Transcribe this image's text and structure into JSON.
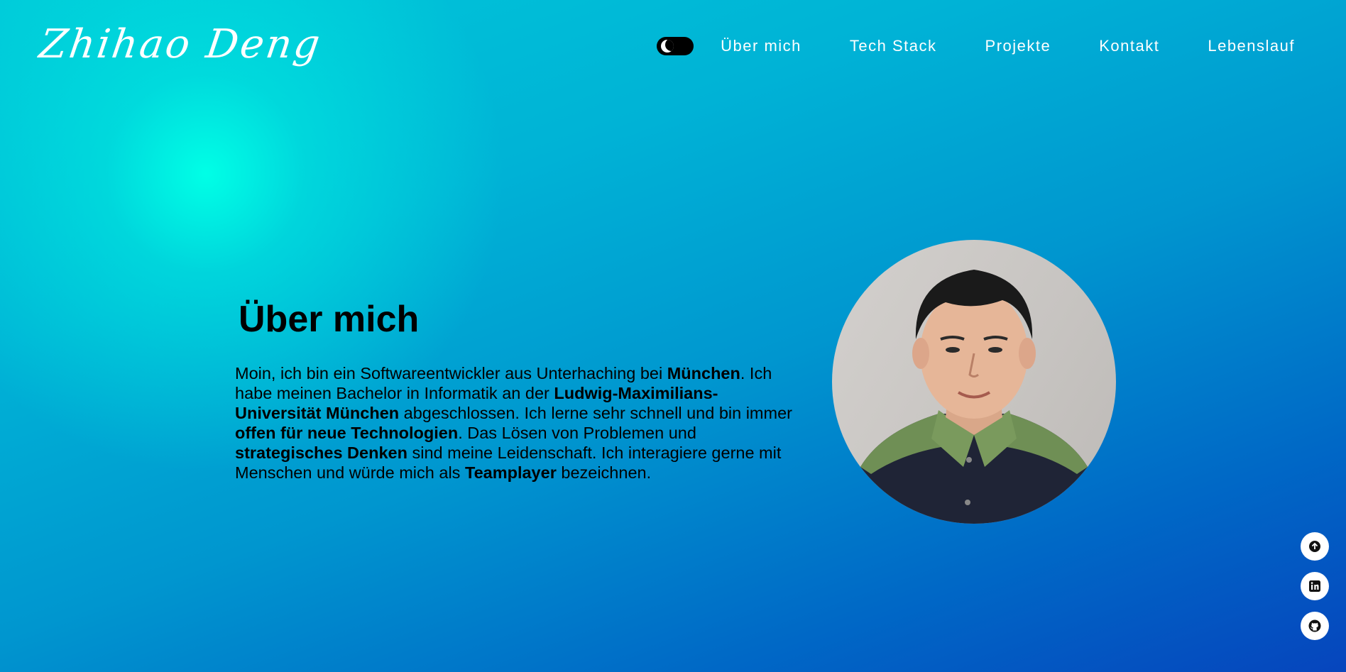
{
  "header": {
    "logo": "Zhihao Deng",
    "theme_toggle": "dark-mode-toggle",
    "nav": [
      {
        "label": "Über mich"
      },
      {
        "label": "Tech Stack"
      },
      {
        "label": "Projekte"
      },
      {
        "label": "Kontakt"
      },
      {
        "label": "Lebenslauf"
      }
    ]
  },
  "about": {
    "title": "Über mich",
    "p1": "Moin, ich bin ein Softwareentwickler aus Unterhaching bei ",
    "b1": "München",
    "p2": ". Ich habe meinen Bachelor in Informatik an der ",
    "b2": "Ludwig-Maximilians-Universität München",
    "p3": " abgeschlossen. Ich lerne sehr schnell und bin immer ",
    "b3": "offen für neue Technologien",
    "p4": ". Das Lösen von Problemen und ",
    "b4": "strategisches Denken",
    "p5": " sind meine Leidenschaft. Ich interagiere gerne mit Menschen und würde mich als ",
    "b5": "Teamplayer",
    "p6": " bezeichnen."
  },
  "side_icons": [
    "arrow-up-icon",
    "linkedin-icon",
    "github-icon"
  ],
  "colors": {
    "accent_light": "#00ffe6",
    "background_top": "#00c9d9",
    "background_bottom": "#0645bd",
    "text": "#000000",
    "nav_text": "#ffffff"
  }
}
